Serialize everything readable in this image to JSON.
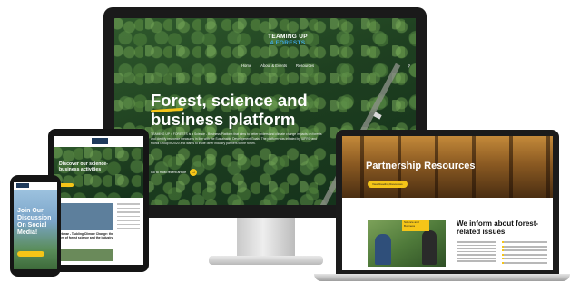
{
  "monitor": {
    "logo_line1": "TEAMING UP",
    "logo_line2": "4 FORESTS",
    "nav": [
      "Home",
      "About & Events",
      "Resources"
    ],
    "hero_title": "Forest, science and business platform",
    "hero_text": "TEAMING UP 4 FORESTS is a Science - Business Platform that aims to better understand climate change impacts on forests and identify response measures in line with the Sustainable Development Goals. The platform was initiated by IUFRO and Mondi Group in 2020 and wants to invite other industry partners to the forum.",
    "cta_label": "Go to most recent article"
  },
  "laptop": {
    "banner_title": "Partnership Resources",
    "banner_button": "View Reading Resources",
    "tag_text": "Science and Business",
    "inform_title": "We inform about forest-related issues"
  },
  "tablet": {
    "hero_title": "Discover our science-business activities",
    "card_caption": "Webinar - Tackling Climate Change: the roles of forest science and the industry"
  },
  "phone": {
    "hero_title": "Join Our Discussion On Social Media!"
  },
  "colors": {
    "accent": "#f5c518",
    "logo_blue": "#3fa7e0",
    "forest_dark": "#1e3f20"
  }
}
